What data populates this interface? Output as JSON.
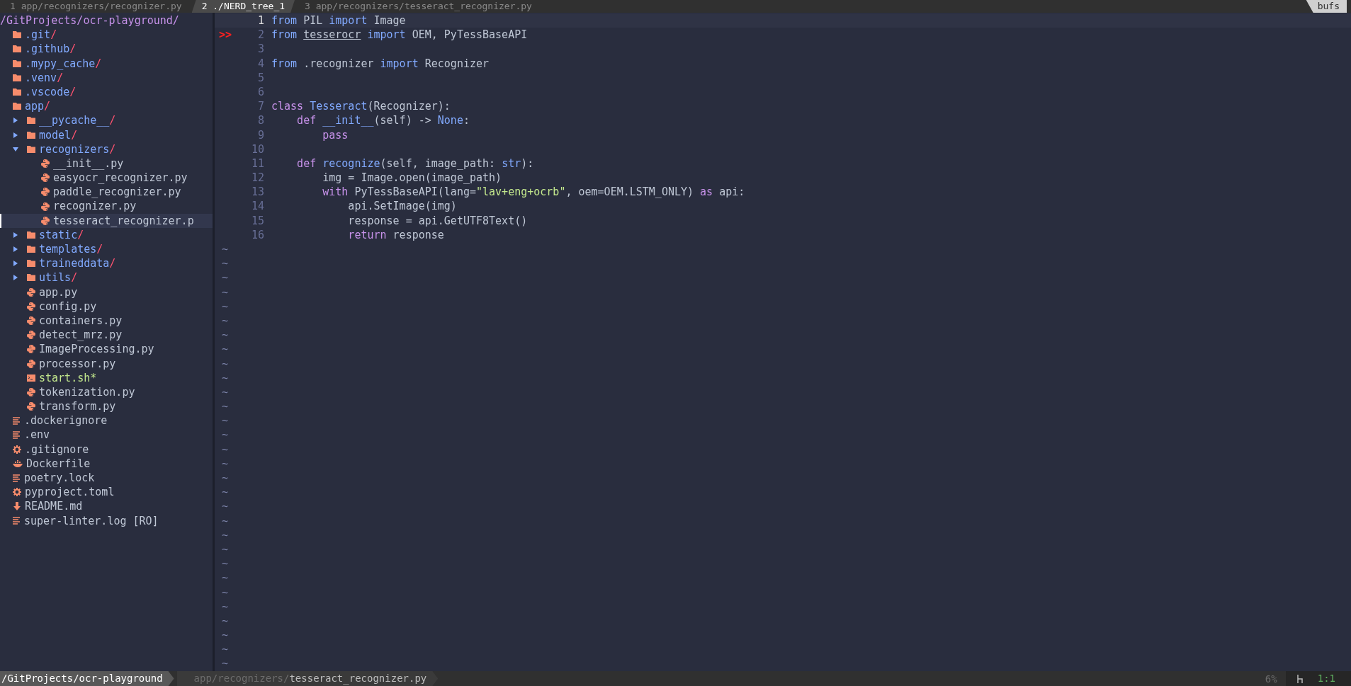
{
  "tabline": {
    "tabs": [
      {
        "label": "1 app/recognizers/recognizer.py",
        "selected": false
      },
      {
        "label": "2 ./NERD_tree_1",
        "selected": true
      },
      {
        "label": "3 app/recognizers/tesseract_recognizer.py",
        "selected": false
      }
    ],
    "right_label": "bufs"
  },
  "tree": {
    "root": "/GitProjects/ocr-playground/",
    "items": [
      {
        "kind": "folder",
        "name": ".git",
        "slash": "/",
        "selected": false
      },
      {
        "kind": "folder",
        "name": ".github",
        "slash": "/",
        "selected": false
      },
      {
        "kind": "folder",
        "name": ".mypy_cache",
        "slash": "/",
        "selected": false
      },
      {
        "kind": "folder",
        "name": ".venv",
        "slash": "/",
        "selected": false
      },
      {
        "kind": "folder",
        "name": ".vscode",
        "slash": "/",
        "selected": false
      },
      {
        "kind": "folder",
        "name": "app",
        "slash": "/",
        "selected": false,
        "children": [
          {
            "kind": "folder",
            "name": "__pycache__",
            "slash": "/",
            "expanded": false,
            "selected": false
          },
          {
            "kind": "folder",
            "name": "model",
            "slash": "/",
            "expanded": false,
            "selected": false
          },
          {
            "kind": "folder",
            "name": "recognizers",
            "slash": "/",
            "expanded": true,
            "selected": false,
            "children": [
              {
                "kind": "python",
                "name": "__init__.py",
                "selected": false
              },
              {
                "kind": "python",
                "name": "easyocr_recognizer.py",
                "selected": false
              },
              {
                "kind": "python",
                "name": "paddle_recognizer.py",
                "selected": false
              },
              {
                "kind": "python",
                "name": "recognizer.py",
                "selected": false
              },
              {
                "kind": "python",
                "name": "tesseract_recognizer.p",
                "selected": true
              }
            ]
          },
          {
            "kind": "folder",
            "name": "static",
            "slash": "/",
            "expanded": false,
            "selected": false
          },
          {
            "kind": "folder",
            "name": "templates",
            "slash": "/",
            "expanded": false,
            "selected": false
          },
          {
            "kind": "folder",
            "name": "traineddata",
            "slash": "/",
            "expanded": false,
            "selected": false
          },
          {
            "kind": "folder",
            "name": "utils",
            "slash": "/",
            "expanded": false,
            "selected": false
          },
          {
            "kind": "python",
            "name": "app.py",
            "selected": false
          },
          {
            "kind": "python",
            "name": "config.py",
            "selected": false
          },
          {
            "kind": "python",
            "name": "containers.py",
            "selected": false
          },
          {
            "kind": "python",
            "name": "detect_mrz.py",
            "selected": false
          },
          {
            "kind": "python",
            "name": "ImageProcessing.py",
            "selected": false
          },
          {
            "kind": "python",
            "name": "processor.py",
            "selected": false
          },
          {
            "kind": "script",
            "name": "start.sh*",
            "selected": false
          },
          {
            "kind": "python",
            "name": "tokenization.py",
            "selected": false
          },
          {
            "kind": "python",
            "name": "transform.py",
            "selected": false
          }
        ]
      },
      {
        "kind": "text",
        "name": ".dockerignore",
        "selected": false
      },
      {
        "kind": "text",
        "name": ".env",
        "selected": false
      },
      {
        "kind": "config",
        "name": ".gitignore",
        "selected": false
      },
      {
        "kind": "docker",
        "name": "Dockerfile",
        "selected": false
      },
      {
        "kind": "text",
        "name": "poetry.lock",
        "selected": false
      },
      {
        "kind": "config",
        "name": "pyproject.toml",
        "selected": false
      },
      {
        "kind": "markdown",
        "name": "README.md",
        "selected": false
      },
      {
        "kind": "text",
        "name": "super-linter.log [RO]",
        "selected": false
      }
    ]
  },
  "editor": {
    "lines": [
      {
        "number": "1",
        "current": true,
        "tokens": [
          {
            "kind": "import",
            "text": "from"
          },
          {
            "kind": "plain",
            "text": " PIL "
          },
          {
            "kind": "import",
            "text": "import"
          },
          {
            "kind": "plain",
            "text": " Image"
          }
        ]
      },
      {
        "number": "2",
        "current": false,
        "sign": ">>",
        "tokens": [
          {
            "kind": "import",
            "text": "from "
          },
          {
            "kind": "underlined",
            "text": "tesserocr"
          },
          {
            "kind": "import",
            "text": " import "
          },
          {
            "kind": "plain",
            "text": "OEM, PyTessBaseAPI"
          }
        ]
      },
      {
        "number": "3",
        "current": false
      },
      {
        "number": "4",
        "current": false,
        "tokens": [
          {
            "kind": "import",
            "text": "from"
          },
          {
            "kind": "plain",
            "text": " .recognizer "
          },
          {
            "kind": "import",
            "text": "import"
          },
          {
            "kind": "plain",
            "text": " Recognizer"
          }
        ]
      },
      {
        "number": "5",
        "current": false
      },
      {
        "number": "6",
        "current": false
      },
      {
        "number": "7",
        "current": false,
        "tokens": [
          {
            "kind": "keyword",
            "text": "class "
          },
          {
            "kind": "name",
            "text": "Tesseract"
          },
          {
            "kind": "plain",
            "text": "(Recognizer):"
          }
        ]
      },
      {
        "number": "8",
        "current": false,
        "tokens": [
          {
            "kind": "keyword",
            "text": "    def "
          },
          {
            "kind": "name",
            "text": "__init__"
          },
          {
            "kind": "plain",
            "text": "(self) -> "
          },
          {
            "kind": "name",
            "text": "None"
          },
          {
            "kind": "plain",
            "text": ":"
          }
        ]
      },
      {
        "number": "9",
        "current": false,
        "tokens": [
          {
            "kind": "keyword",
            "text": "        pass"
          }
        ]
      },
      {
        "number": "10",
        "current": false
      },
      {
        "number": "11",
        "current": false,
        "tokens": [
          {
            "kind": "keyword",
            "text": "    def "
          },
          {
            "kind": "name",
            "text": "recognize"
          },
          {
            "kind": "plain",
            "text": "(self, image_path: "
          },
          {
            "kind": "name",
            "text": "str"
          },
          {
            "kind": "plain",
            "text": "):"
          }
        ]
      },
      {
        "number": "12",
        "current": false,
        "tokens": [
          {
            "kind": "plain",
            "text": "        img = Image.open(image_path)"
          }
        ]
      },
      {
        "number": "13",
        "current": false,
        "tokens": [
          {
            "kind": "keyword",
            "text": "        with"
          },
          {
            "kind": "plain",
            "text": " PyTessBaseAPI(lang="
          },
          {
            "kind": "string",
            "text": "\"lav+eng+ocrb\""
          },
          {
            "kind": "plain",
            "text": ", oem=OEM.LSTM_ONLY) "
          },
          {
            "kind": "keyword",
            "text": "as"
          },
          {
            "kind": "plain",
            "text": " api:"
          }
        ]
      },
      {
        "number": "14",
        "current": false,
        "tokens": [
          {
            "kind": "plain",
            "text": "            api.SetImage(img)"
          }
        ]
      },
      {
        "number": "15",
        "current": false,
        "tokens": [
          {
            "kind": "plain",
            "text": "            response = api.GetUTF8Text()"
          }
        ]
      },
      {
        "number": "16",
        "current": false,
        "tokens": [
          {
            "kind": "keyword",
            "text": "            return"
          },
          {
            "kind": "plain",
            "text": " response"
          }
        ]
      }
    ],
    "filler": [
      "~",
      "~",
      "~",
      "~",
      "~",
      "~",
      "~",
      "~",
      "~",
      "~",
      "~",
      "~",
      "~",
      "~",
      "~",
      "~",
      "~",
      "~",
      "~",
      "~",
      "~",
      "~",
      "~",
      "~",
      "~",
      "~",
      "~",
      "~",
      "~",
      "~"
    ]
  },
  "status_bar": {
    "tree_path": "/GitProjects/ocr-playground",
    "file_dir": "app/recognizers/",
    "file_name": "tesseract_recognizer.py",
    "percent": "6%",
    "position": "1:1"
  }
}
